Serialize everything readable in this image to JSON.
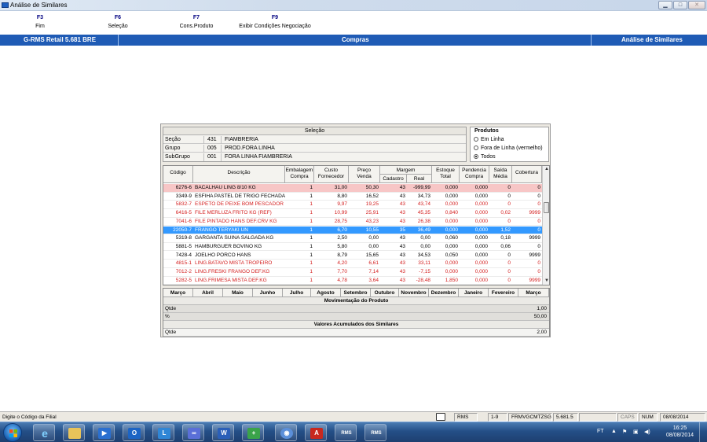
{
  "window": {
    "title": "Análise de Similares",
    "min_label": "▁",
    "max_label": "□",
    "close_label": "✕"
  },
  "fkeys": [
    {
      "key": "F3",
      "label": "Fim"
    },
    {
      "key": "F6",
      "label": "Seleção"
    },
    {
      "key": "F7",
      "label": "Cons.Produto"
    },
    {
      "key": "F9",
      "label": "Exibir Condições Negociação"
    }
  ],
  "header": {
    "left": "G-RMS Retail 5.681 BRE",
    "center": "Compras",
    "right": "Análise de Similares",
    "color": "#1f5bb5"
  },
  "selecao": {
    "title": "Seleção",
    "rows": [
      {
        "label": "Seção",
        "code": "431",
        "name": "FIAMBRERIA"
      },
      {
        "label": "Grupo",
        "code": "005",
        "name": "PROD.FORA LINHA"
      },
      {
        "label": "SubGrupo",
        "code": "001",
        "name": "FORA LINHA FIAMBRERIA"
      }
    ]
  },
  "produtos": {
    "title": "Produtos",
    "options": [
      {
        "label": "Em Linha",
        "checked": false
      },
      {
        "label": "Fora de Linha (vermelho)",
        "checked": false
      },
      {
        "label": "Todos",
        "checked": true
      }
    ]
  },
  "grid": {
    "headers": {
      "codigo": "Código",
      "descricao": "Descrição",
      "embalagem": [
        "Embalagem",
        "Compra"
      ],
      "custo": [
        "Custo",
        "Fornecedor"
      ],
      "preco": [
        "Preço",
        "Venda"
      ],
      "margem": "Margem",
      "cadastro": "Cadastro",
      "real": "Real",
      "estoque": [
        "Estoque",
        "Total"
      ],
      "pendencia": [
        "Pendencia",
        "Compra"
      ],
      "saida": [
        "Saída",
        "Média"
      ],
      "cobertura": "Cobertura"
    },
    "rows": [
      {
        "codigo": "6276-6",
        "desc": "BACALHAU LING 8/10 KG",
        "emb": "1",
        "custo": "31,00",
        "preco": "50,30",
        "cad": "43",
        "real": "-999,99",
        "estoque": "0,000",
        "pend": "0,000",
        "saida": "0",
        "cob": "0",
        "style": "pink"
      },
      {
        "codigo": "3349-9",
        "desc": "ESFIHA PASTEL DE TRIGO FECHADA",
        "emb": "1",
        "custo": "8,80",
        "preco": "16,52",
        "cad": "43",
        "real": "34,73",
        "estoque": "0,000",
        "pend": "0,000",
        "saida": "0",
        "cob": "0",
        "style": "normal"
      },
      {
        "codigo": "5832-7",
        "desc": "ESPETO DE PEIXE BOM PESCADOR",
        "emb": "1",
        "custo": "9,97",
        "preco": "19,25",
        "cad": "43",
        "real": "43,74",
        "estoque": "0,000",
        "pend": "0,000",
        "saida": "0",
        "cob": "0",
        "style": "red"
      },
      {
        "codigo": "6416-5",
        "desc": "FILE MERLUZA FRITO KG (REF)",
        "emb": "1",
        "custo": "10,99",
        "preco": "25,91",
        "cad": "43",
        "real": "45,35",
        "estoque": "0,840",
        "pend": "0,000",
        "saida": "0,02",
        "cob": "9999",
        "style": "red"
      },
      {
        "codigo": "7041-6",
        "desc": "FILE PINTADO HANS DEF.CRV KG",
        "emb": "1",
        "custo": "28,75",
        "preco": "43,23",
        "cad": "43",
        "real": "26,38",
        "estoque": "0,000",
        "pend": "0,000",
        "saida": "0",
        "cob": "0",
        "style": "red"
      },
      {
        "codigo": "22050-7",
        "desc": "FRANGO TERYAKI UN",
        "emb": "1",
        "custo": "6,70",
        "preco": "10,55",
        "cad": "35",
        "real": "36,49",
        "estoque": "0,000",
        "pend": "0,000",
        "saida": "1,52",
        "cob": "0",
        "style": "sel"
      },
      {
        "codigo": "5319-8",
        "desc": "GARGANTA SUINA SALGADA KG",
        "emb": "1",
        "custo": "2,50",
        "preco": "0,00",
        "cad": "43",
        "real": "0,00",
        "estoque": "0,060",
        "pend": "0,000",
        "saida": "0,18",
        "cob": "9999",
        "style": "normal"
      },
      {
        "codigo": "5881-5",
        "desc": "HAMBURGUER BOVINO KG",
        "emb": "1",
        "custo": "5,80",
        "preco": "0,00",
        "cad": "43",
        "real": "0,00",
        "estoque": "0,000",
        "pend": "0,000",
        "saida": "0,06",
        "cob": "0",
        "style": "normal"
      },
      {
        "codigo": "7428-4",
        "desc": "JOELHO PORCO HANS",
        "emb": "1",
        "custo": "8,79",
        "preco": "15,65",
        "cad": "43",
        "real": "34,53",
        "estoque": "0,050",
        "pend": "0,000",
        "saida": "0",
        "cob": "9999",
        "style": "normal"
      },
      {
        "codigo": "4815-1",
        "desc": "LING.BATAVO MISTA TROPEIRO",
        "emb": "1",
        "custo": "4,20",
        "preco": "6,61",
        "cad": "43",
        "real": "33,11",
        "estoque": "0,000",
        "pend": "0,000",
        "saida": "0",
        "cob": "0",
        "style": "red"
      },
      {
        "codigo": "7012-2",
        "desc": "LING.FRESKI FRANGO DEF.KG",
        "emb": "1",
        "custo": "7,70",
        "preco": "7,14",
        "cad": "43",
        "real": "-7,15",
        "estoque": "0,000",
        "pend": "0,000",
        "saida": "0",
        "cob": "0",
        "style": "red"
      },
      {
        "codigo": "5282-5",
        "desc": "LING.FRIMESA MISTA DEF.KG",
        "emb": "1",
        "custo": "4,78",
        "preco": "3,64",
        "cad": "43",
        "real": "-28,48",
        "estoque": "1,850",
        "pend": "0,000",
        "saida": "0",
        "cob": "9999",
        "style": "red"
      }
    ]
  },
  "scroll": {
    "up": "▲",
    "down": "▼"
  },
  "months": {
    "headers": [
      "Março",
      "Abril",
      "Maio",
      "Junho",
      "Julho",
      "Agosto",
      "Setembro",
      "Outubro",
      "Novembro",
      "Dezembro",
      "Janeiro",
      "Fevereiro",
      "Março"
    ],
    "section1": "Movimentação do Produto",
    "qtde_label": "Qtde",
    "qtde_value": "1,00",
    "pct_label": "%",
    "pct_value": "50,00",
    "section2": "Valores Acumulados dos Similares",
    "acum_label": "Qtde",
    "acum_value": "2,00"
  },
  "statusbar": {
    "message": "Digite o Código da Filial",
    "rms": "RMS",
    "range": "1-9",
    "host": "FRMVGCMTZSG",
    "version": "5.681.5",
    "caps": "CAPS",
    "num": "NUM",
    "date": "08/08/2014"
  },
  "taskbar": {
    "tray_lang": "FT",
    "time": "16:25",
    "date": "08/08/2014",
    "apps": [
      "ie",
      "explorer",
      "media",
      "outlook",
      "lync",
      "infopath",
      "word",
      "app-install",
      "chrome",
      "pdf",
      "rms-1",
      "rms-2"
    ],
    "rms_label": "RMS"
  }
}
